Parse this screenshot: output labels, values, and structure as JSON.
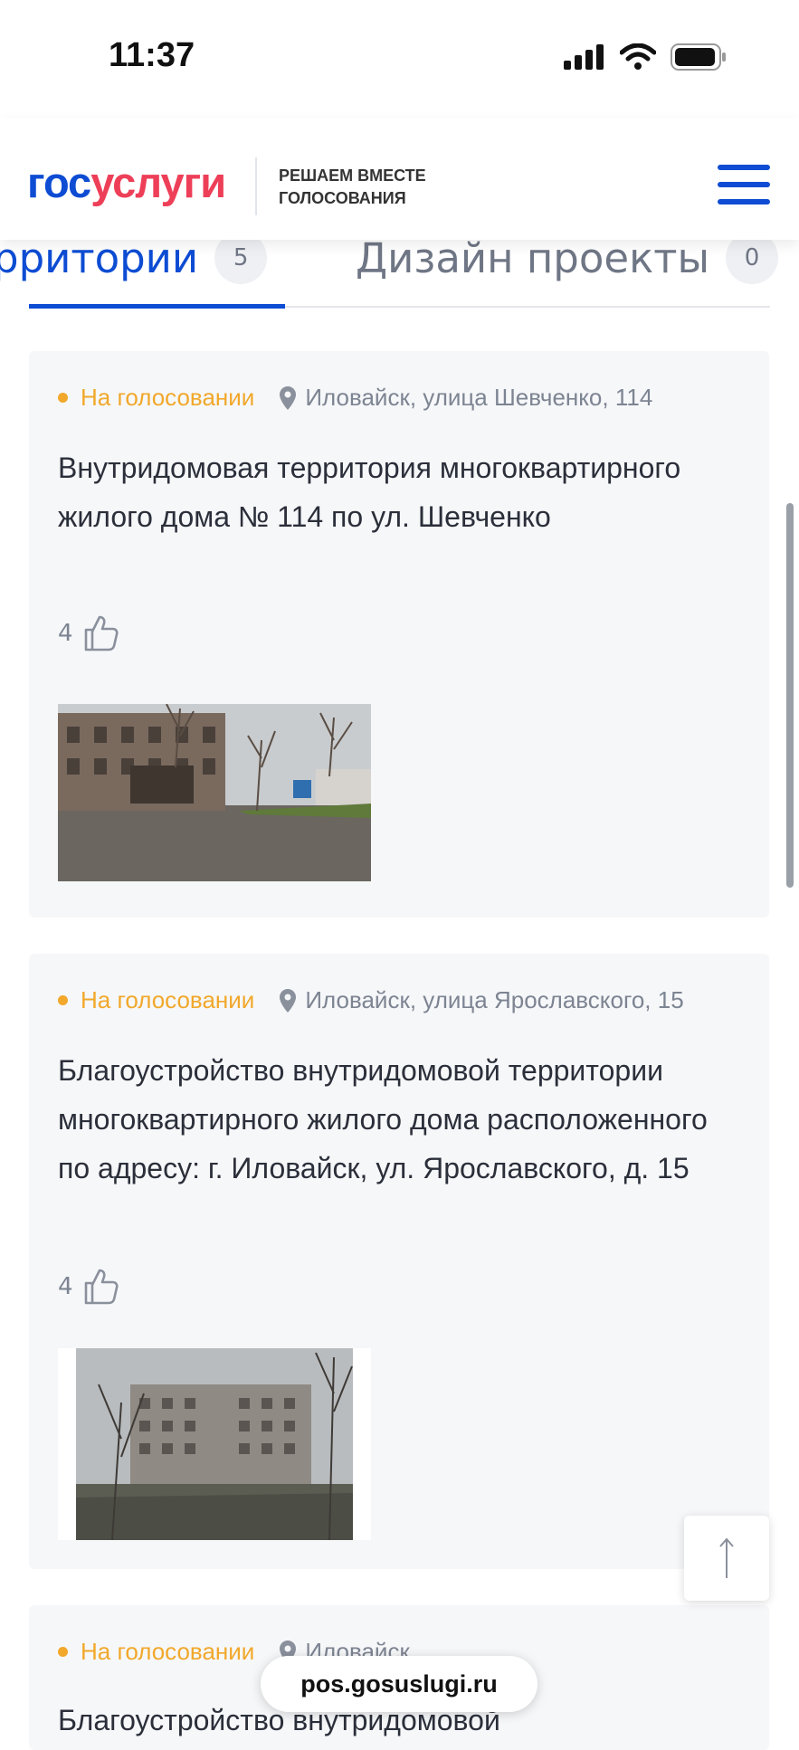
{
  "status_bar": {
    "time": "11:37"
  },
  "header": {
    "logo_part1": "гос",
    "logo_part2": "услуги",
    "motto_line1": "РЕШАЕМ ВМЕСТЕ",
    "motto_line2": "ГОЛОСОВАНИЯ",
    "menu_icon": "hamburger-menu-icon"
  },
  "tabs": [
    {
      "label": "рритории",
      "count": "5",
      "active": true
    },
    {
      "label": "Дизайн проекты",
      "count": "0",
      "active": false
    }
  ],
  "cards": [
    {
      "status": "На голосовании",
      "address": "Иловайск, улица Шевченко, 114",
      "title": "Внутридомовая территория многоквартирного жилого дома № 114 по ул. Шевченко",
      "likes": "4"
    },
    {
      "status": "На голосовании",
      "address": "Иловайск, улица Ярославского, 15",
      "title": "Благоустройство внутридомовой территории многоквартирного жилого дома расположенного по адресу: г. Иловайск, ул. Ярославского, д. 15",
      "likes": "4"
    },
    {
      "status": "На голосовании",
      "address": "Иловайск",
      "title": "Благоустройство внутридомовой"
    }
  ],
  "browser": {
    "url": "pos.gosuslugi.ru"
  },
  "colors": {
    "accent": "#0d4cd3",
    "logo_red": "#ee3f58",
    "status_orange": "#f1a82b"
  }
}
